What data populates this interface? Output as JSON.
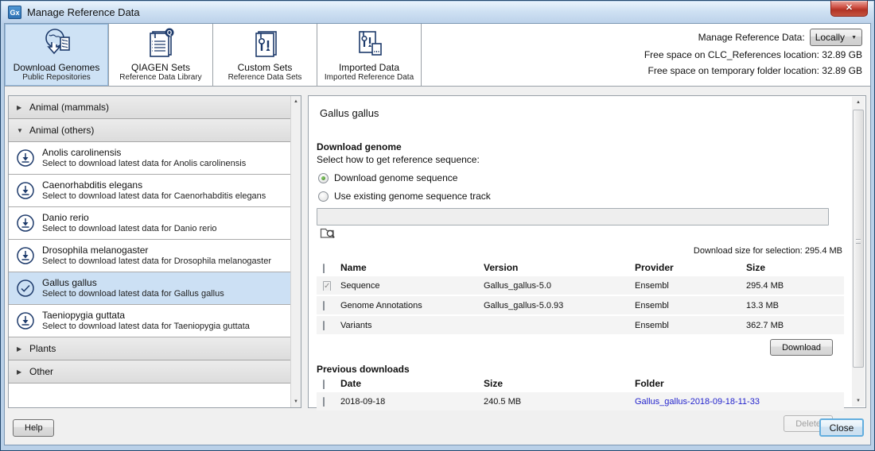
{
  "window": {
    "app_badge": "Gx",
    "title": "Manage Reference Data",
    "close_glyph": "✕"
  },
  "toolbar": {
    "tabs": [
      {
        "label": "Download Genomes",
        "sublabel": "Public Repositories"
      },
      {
        "label": "QIAGEN Sets",
        "sublabel": "Reference Data Library"
      },
      {
        "label": "Custom Sets",
        "sublabel": "Reference Data Sets"
      },
      {
        "label": "Imported Data",
        "sublabel": "Imported Reference Data"
      }
    ],
    "manage_label": "Manage Reference Data:",
    "location_value": "Locally",
    "free_space_clc": "Free space on CLC_References location: 32.89 GB",
    "free_space_temp": "Free space on temporary folder location: 32.89 GB"
  },
  "sidebar": {
    "group_mammals": "Animal (mammals)",
    "group_others": "Animal (others)",
    "group_plants": "Plants",
    "group_other": "Other",
    "items": [
      {
        "title": "Anolis carolinensis",
        "subtitle": "Select to download latest data for Anolis carolinensis"
      },
      {
        "title": "Caenorhabditis elegans",
        "subtitle": "Select to download latest data for Caenorhabditis elegans"
      },
      {
        "title": "Danio rerio",
        "subtitle": "Select to download latest data for Danio rerio"
      },
      {
        "title": "Drosophila melanogaster",
        "subtitle": "Select to download latest data for Drosophila melanogaster"
      },
      {
        "title": "Gallus gallus",
        "subtitle": "Select to download latest data for Gallus gallus"
      },
      {
        "title": "Taeniopygia guttata",
        "subtitle": "Select to download latest data for Taeniopygia guttata"
      }
    ]
  },
  "panel": {
    "title": "Gallus gallus",
    "section_heading": "Download genome",
    "instruction": "Select how to get reference sequence:",
    "radio_download": "Download genome sequence",
    "radio_existing": "Use existing genome sequence track",
    "track_input_value": "",
    "download_size": "Download size for selection: 295.4 MB",
    "files_table": {
      "col_name": "Name",
      "col_version": "Version",
      "col_provider": "Provider",
      "col_size": "Size",
      "rows": [
        {
          "name": "Sequence",
          "version": "Gallus_gallus-5.0",
          "provider": "Ensembl",
          "size": "295.4 MB",
          "checked": true
        },
        {
          "name": "Genome Annotations",
          "version": "Gallus_gallus-5.0.93",
          "provider": "Ensembl",
          "size": "13.3 MB",
          "checked": false
        },
        {
          "name": "Variants",
          "version": "",
          "provider": "Ensembl",
          "size": "362.7 MB",
          "checked": false
        }
      ]
    },
    "download_button": "Download",
    "previous": {
      "heading": "Previous downloads",
      "col_date": "Date",
      "col_size": "Size",
      "col_folder": "Folder",
      "rows": [
        {
          "date": "2018-09-18",
          "size": "240.5 MB",
          "folder": "Gallus_gallus-2018-09-18-11-33",
          "checked": false
        }
      ]
    },
    "delete_button": "Delete"
  },
  "footer": {
    "help": "Help",
    "close": "Close"
  },
  "colors": {
    "icon_navy": "#1d3a6b",
    "selection_blue": "#cce0f4",
    "link_blue": "#2323cc",
    "close_red": "#b23325"
  }
}
